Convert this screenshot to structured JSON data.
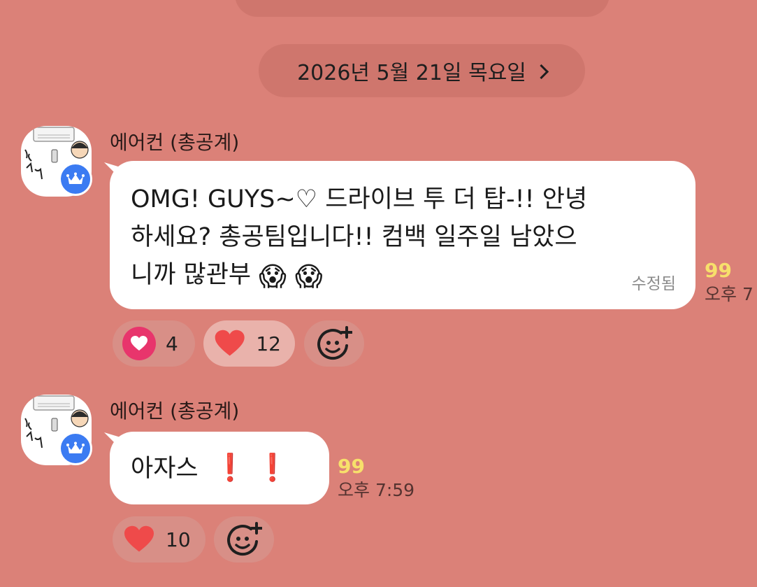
{
  "date_divider": {
    "label": "2026년 5월 21일 목요일",
    "chevron_icon": "chevron-right-icon"
  },
  "colors": {
    "background": "#db8178",
    "pill": "#cf766d",
    "bubble": "#ffffff",
    "unread": "#f7e06b",
    "badge": "#3b7bf2",
    "heart_circle": "#e8356c",
    "heart": "#ef4a4a"
  },
  "messages": [
    {
      "sender": "에어컨 (총공계)",
      "avatar_icon": "air-conditioner-avatar",
      "badge_icon": "crown-icon",
      "text_line1": "OMG! GUYS~♡ 드라이브 투 더 탑-!! 안녕",
      "text_line2": "하세요? 총공팀입니다!! 컴백 일주일 남았으",
      "text_line3": "니까 많관부",
      "emoji": "😱 😱",
      "edited_label": "수정됨",
      "unread_count": "99",
      "time": "오후 7",
      "reactions": [
        {
          "icon": "heart-circle-icon",
          "count": "4",
          "active": false
        },
        {
          "icon": "heart-icon",
          "count": "12",
          "active": true
        }
      ],
      "add_reaction_icon": "add-reaction-icon"
    },
    {
      "sender": "에어컨 (총공계)",
      "avatar_icon": "air-conditioner-avatar",
      "badge_icon": "crown-icon",
      "text": "아자스",
      "exclaim": "❗ ❗",
      "unread_count": "99",
      "time": "오후 7:59",
      "reactions": [
        {
          "icon": "heart-icon",
          "count": "10",
          "active": false
        }
      ],
      "add_reaction_icon": "add-reaction-icon"
    }
  ]
}
